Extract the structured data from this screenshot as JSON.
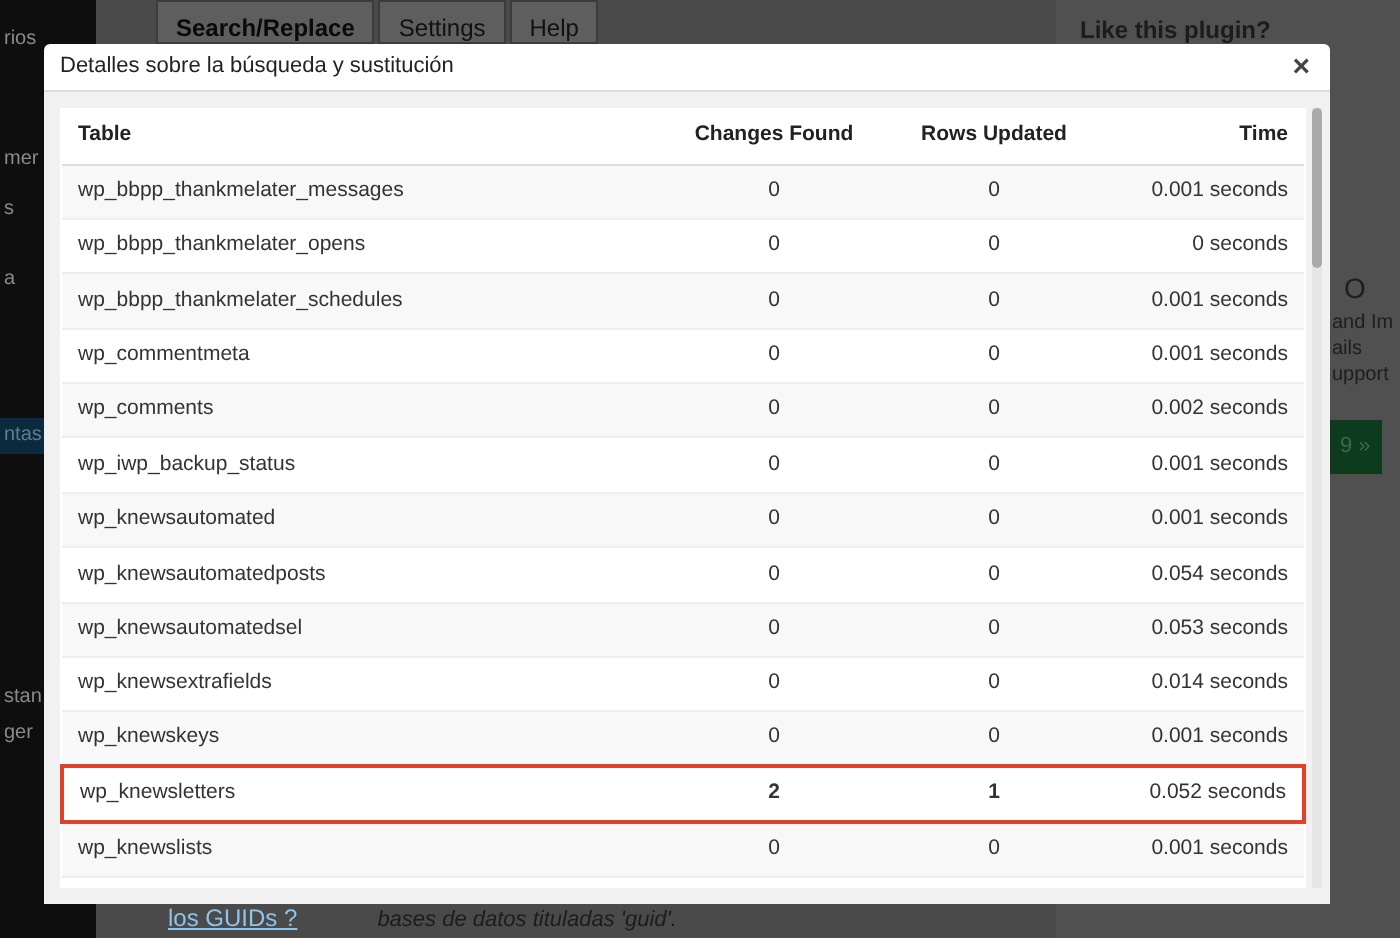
{
  "sidebar": {
    "items": [
      {
        "label": "rios",
        "selected": false
      },
      {
        "label": "mer",
        "selected": false
      },
      {
        "label": "s",
        "selected": false
      },
      {
        "label": "a",
        "selected": false
      },
      {
        "label": "ntas",
        "selected": true
      },
      {
        "label": "stan",
        "selected": false
      },
      {
        "label": "ger",
        "selected": false
      }
    ]
  },
  "tabs": [
    {
      "label": "Search/Replace",
      "selected": true
    },
    {
      "label": "Settings",
      "selected": false
    },
    {
      "label": "Help",
      "selected": false
    }
  ],
  "right_panel": {
    "title": "Like this plugin?",
    "heading": "O",
    "lines": [
      "and Im",
      "ails",
      "upport"
    ],
    "button": "9 »"
  },
  "footer": {
    "link": "los GUIDs ?",
    "text": "bases de datos tituladas 'guid'."
  },
  "modal": {
    "title": "Detalles sobre la búsqueda y sustitución",
    "close": "×",
    "table": {
      "columns": [
        "Table",
        "Changes Found",
        "Rows Updated",
        "Time"
      ],
      "rows": [
        {
          "cells": [
            "wp_bbpp_thankmelater_messages",
            "0",
            "0",
            "0.001 seconds"
          ],
          "highlighted": false
        },
        {
          "cells": [
            "wp_bbpp_thankmelater_opens",
            "0",
            "0",
            "0 seconds"
          ],
          "highlighted": false
        },
        {
          "cells": [
            "wp_bbpp_thankmelater_schedules",
            "0",
            "0",
            "0.001 seconds"
          ],
          "highlighted": false
        },
        {
          "cells": [
            "wp_commentmeta",
            "0",
            "0",
            "0.001 seconds"
          ],
          "highlighted": false
        },
        {
          "cells": [
            "wp_comments",
            "0",
            "0",
            "0.002 seconds"
          ],
          "highlighted": false
        },
        {
          "cells": [
            "wp_iwp_backup_status",
            "0",
            "0",
            "0.001 seconds"
          ],
          "highlighted": false
        },
        {
          "cells": [
            "wp_knewsautomated",
            "0",
            "0",
            "0.001 seconds"
          ],
          "highlighted": false
        },
        {
          "cells": [
            "wp_knewsautomatedposts",
            "0",
            "0",
            "0.054 seconds"
          ],
          "highlighted": false
        },
        {
          "cells": [
            "wp_knewsautomatedsel",
            "0",
            "0",
            "0.053 seconds"
          ],
          "highlighted": false
        },
        {
          "cells": [
            "wp_knewsextrafields",
            "0",
            "0",
            "0.014 seconds"
          ],
          "highlighted": false
        },
        {
          "cells": [
            "wp_knewskeys",
            "0",
            "0",
            "0.001 seconds"
          ],
          "highlighted": false
        },
        {
          "cells": [
            "wp_knewsletters",
            "2",
            "1",
            "0.052 seconds"
          ],
          "highlighted": true
        },
        {
          "cells": [
            "wp_knewslists",
            "0",
            "0",
            "0.001 seconds"
          ],
          "highlighted": false
        }
      ]
    }
  }
}
